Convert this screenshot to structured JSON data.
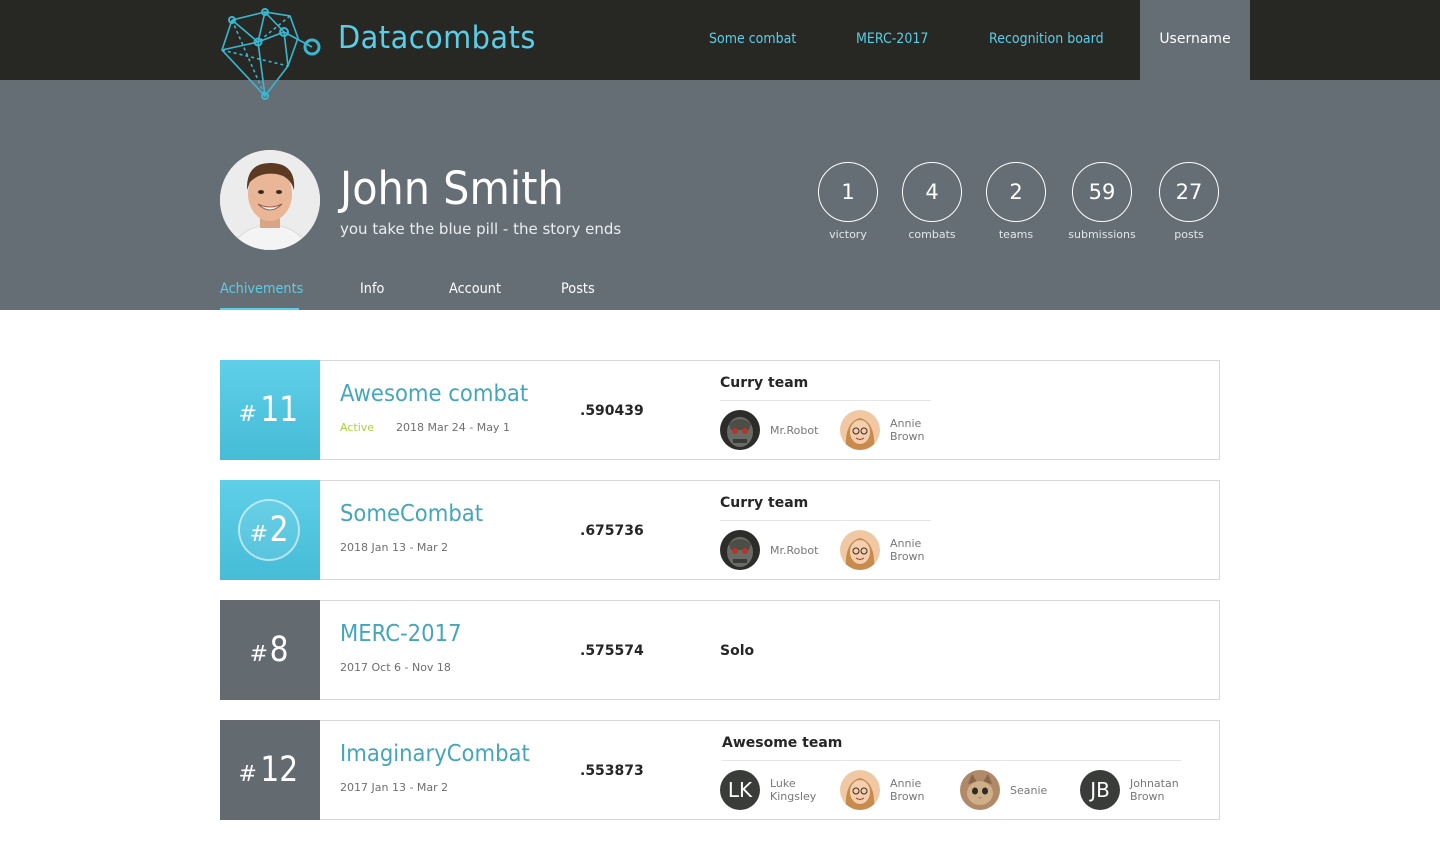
{
  "header": {
    "brand": "Datacombats",
    "nav": [
      "Some combat",
      "MERC-2017",
      "Recognition board"
    ],
    "user_menu": "Username"
  },
  "profile": {
    "name": "John Smith",
    "tagline": "you take the blue pill - the story ends",
    "stats": [
      {
        "value": "1",
        "label": "victory"
      },
      {
        "value": "4",
        "label": "combats"
      },
      {
        "value": "2",
        "label": "teams"
      },
      {
        "value": "59",
        "label": "submissions"
      },
      {
        "value": "27",
        "label": "posts"
      }
    ],
    "tabs": [
      "Achivements",
      "Info",
      "Account",
      "Posts"
    ],
    "active_tab": "Achivements"
  },
  "achievements": [
    {
      "hash": "#",
      "rank": "11",
      "combat": "Awesome combat",
      "status": "Active",
      "dates": "2018 Mar 24 - May 1",
      "score": ".590439",
      "team": "Curry team",
      "members": [
        {
          "name_lines": [
            "Mr.Robot"
          ]
        },
        {
          "name_lines": [
            "Annie",
            "Brown"
          ]
        }
      ]
    },
    {
      "hash": "#",
      "rank": "2",
      "combat": "SomeCombat",
      "status": "",
      "dates": "2018 Jan 13 - Mar 2",
      "score": ".675736",
      "team": "Curry team",
      "members": [
        {
          "name_lines": [
            "Mr.Robot"
          ]
        },
        {
          "name_lines": [
            "Annie",
            "Brown"
          ]
        }
      ]
    },
    {
      "hash": "#",
      "rank": "8",
      "combat": "MERC-2017",
      "status": "",
      "dates": "2017 Oct 6 - Nov 18",
      "score": ".575574",
      "team": "Solo",
      "members": []
    },
    {
      "hash": "#",
      "rank": "12",
      "combat": "ImaginaryCombat",
      "status": "",
      "dates": "2017 Jan 13 - Mar 2",
      "score": ".553873",
      "team": "Awesome team",
      "members": [
        {
          "initials": "LK",
          "name_lines": [
            "Luke",
            "Kingsley"
          ]
        },
        {
          "name_lines": [
            "Annie",
            "Brown"
          ]
        },
        {
          "name_lines": [
            "Seanie"
          ]
        },
        {
          "initials": "JB",
          "name_lines": [
            "Johnatan",
            "Brown"
          ]
        }
      ]
    }
  ],
  "colors": {
    "topbar": "#272824",
    "profile_bg": "#656d75",
    "accent": "#5ccde6",
    "combat_link": "#44a6bb",
    "active_status": "#a7d23d",
    "rank_grey": "#636a70"
  },
  "icons": [
    "datacombats-logo-icon",
    "robot-avatar-icon",
    "woman-avatar-icon",
    "cat-avatar-icon",
    "user-photo-icon"
  ]
}
